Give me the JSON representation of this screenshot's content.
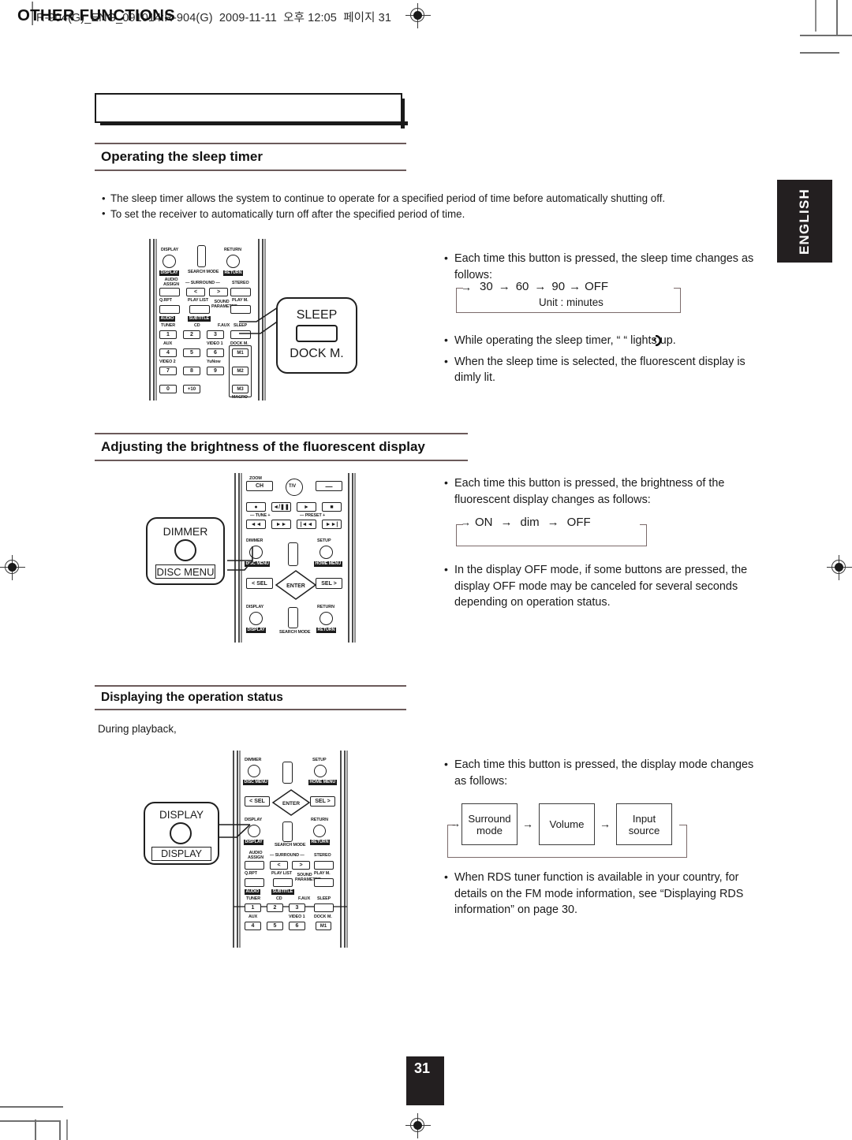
{
  "print_header": {
    "text": "R-904(G)_ENG_091014:R-904(G)  2009-11-11  오후 12:05  페이지 31"
  },
  "chapter": {
    "title": "OTHER FUNCTIONS"
  },
  "language_tab": {
    "label": "ENGLISH"
  },
  "page_number": {
    "value": "31"
  },
  "sections": [
    {
      "heading": "Operating the sleep timer",
      "intro_bullets": [
        "The sleep timer allows the system to continue to operate for a specified period of time before automatically shutting off.",
        "To set the receiver to automatically turn off after the specified period of time."
      ],
      "right_bullets": [
        "Each time this button is pressed, the sleep time changes as follows:",
        "While operating the sleep timer, “      “ lights up.",
        "When the sleep time is selected, the fluorescent display is dimly lit."
      ],
      "flow": {
        "steps": [
          "30",
          "60",
          "90",
          "OFF"
        ],
        "arrow": "→",
        "note": "Unit : minutes"
      },
      "callout": {
        "top_label": "SLEEP",
        "bottom_label": "DOCK M."
      }
    },
    {
      "heading": "Adjusting the brightness of the fluorescent display",
      "right_bullets": [
        "Each time this button is pressed, the brightness of the fluorescent display changes as follows:",
        "In the display OFF mode, if some buttons are pressed, the display OFF mode may be canceled for several seconds depending on operation status."
      ],
      "flow": {
        "steps": [
          "ON",
          "dim",
          "OFF"
        ],
        "arrow": "→"
      },
      "callout": {
        "top_label": "DIMMER",
        "bottom_label": "DISC MENU"
      }
    },
    {
      "heading": "Displaying the operation status",
      "lead_text": "During playback,",
      "right_bullets": [
        "Each time this button is pressed, the display mode changes as follows:",
        "When RDS tuner function is available in your country, for details on the FM mode information, see “Displaying RDS information” on page 30."
      ],
      "flow": {
        "boxes": [
          "Surround mode",
          "Volume",
          "Input source"
        ],
        "arrow": "→"
      },
      "callout": {
        "top_label": "DISPLAY",
        "bottom_label": "DISPLAY"
      }
    }
  ],
  "remote_labels": {
    "display": "DISPLAY",
    "return": "RETURN",
    "search_mode": "SEARCH MODE",
    "audio_assign": "AUDIO ASSIGN",
    "surround": "— SURROUND —",
    "stereo": "STEREO",
    "q_rpt": "Q.RPT",
    "play_list": "PLAY LIST",
    "play_m": "PLAY M.",
    "sound_parameter": "SOUND PARAMETER",
    "audio": "AUDIO",
    "subtitle": "SUBTITLE",
    "tuner": "TUNER",
    "cd": "CD",
    "f_aux": "F.AUX",
    "sleep": "SLEEP",
    "aux": "AUX",
    "video1": "VIDEO 1",
    "dock_m": "DOCK M.",
    "video2": "VIDEO 2",
    "yunow": "YuNow",
    "macro": "MACRO",
    "m1": "M1",
    "m2": "M2",
    "m3": "M3",
    "num0": "0",
    "num1": "1",
    "num2": "2",
    "num3": "3",
    "num4": "4",
    "num5": "5",
    "num6": "6",
    "num7": "7",
    "num8": "8",
    "num9": "9",
    "plus10": "+10",
    "ch": "CH",
    "tv": "T/V",
    "tune": "— TUNE +",
    "preset": "— PRESET +",
    "dimmer": "DIMMER",
    "setup": "SETUP",
    "disc_menu": "DISC MENU",
    "home_menu": "HOME MENU",
    "sel_left": "< SEL",
    "sel_right": "SEL >",
    "enter": "ENTER",
    "arrow_left": "◄",
    "arrow_right": "►",
    "lt_sym": "<",
    "gt_sym": ">"
  },
  "colors": {
    "rule": "#6b5a5a",
    "ink": "#1a1a1a",
    "tab_bg": "#231f20"
  }
}
